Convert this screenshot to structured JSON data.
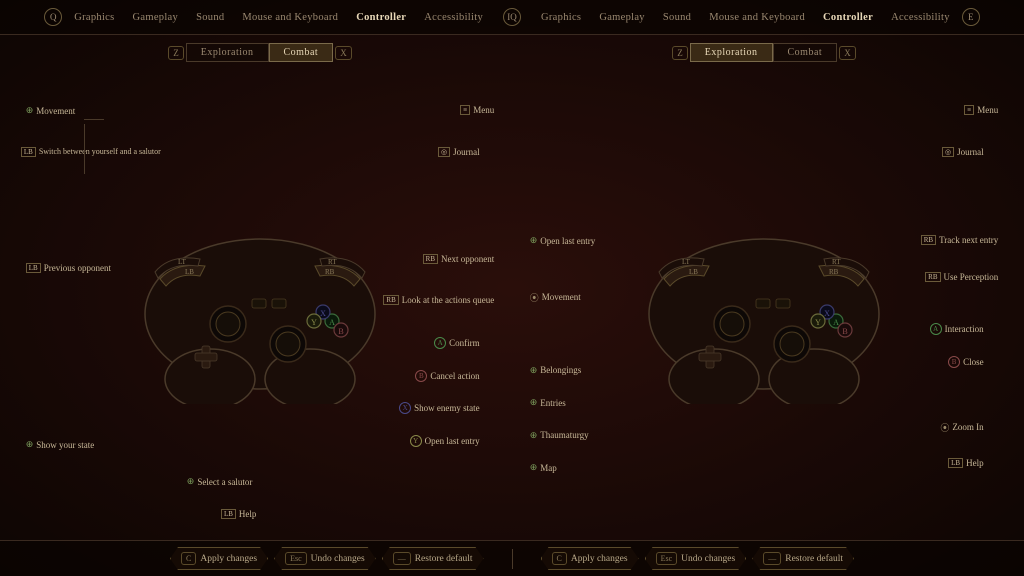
{
  "nav": {
    "left_q": "Q",
    "items_left": [
      "Graphics",
      "Gameplay",
      "Sound",
      "Mouse and Keyboard",
      "Controller",
      "Accessibility"
    ],
    "middle_iq": "IQ",
    "items_right": [
      "Graphics",
      "Gameplay",
      "Sound",
      "Mouse and Keyboard",
      "Controller",
      "Accessibility"
    ],
    "right_e": "E",
    "active": "Controller"
  },
  "panels": [
    {
      "id": "left",
      "tabs": [
        {
          "key": "Z",
          "label": "Exploration",
          "active": false
        },
        {
          "key": null,
          "label": "Combat",
          "active": true
        },
        {
          "key": "X",
          "label": null,
          "active": false
        }
      ],
      "labels_left": [
        {
          "text": "Movement",
          "icon": "dpad",
          "top": "16%",
          "left": "9%"
        },
        {
          "text": "Switch between yourself and a salutor",
          "icon": "lb",
          "top": "22%",
          "left": "5%"
        },
        {
          "text": "Previous opponent",
          "icon": "lb",
          "top": "40%",
          "left": "6%"
        },
        {
          "text": "Show your state",
          "icon": "dpad",
          "top": "76%",
          "left": "9%"
        }
      ],
      "labels_right": [
        {
          "text": "Menu",
          "icon": "menu",
          "top": "16%",
          "right": "5%"
        },
        {
          "text": "Journal",
          "icon": "menu",
          "top": "22%",
          "right": "8%"
        },
        {
          "text": "Next opponent",
          "icon": "rb",
          "top": "40%",
          "right": "5%"
        },
        {
          "text": "Look at the actions queue",
          "icon": "rb",
          "top": "46%",
          "right": "5%"
        },
        {
          "text": "Confirm",
          "icon": "a",
          "top": "54%",
          "right": "8%"
        },
        {
          "text": "Cancel action",
          "icon": "b",
          "top": "60%",
          "right": "8%"
        },
        {
          "text": "Show enemy state",
          "icon": "x",
          "top": "66%",
          "right": "8%"
        },
        {
          "text": "Open last entry",
          "icon": "y",
          "top": "72%",
          "right": "8%"
        },
        {
          "text": "Select a salutor",
          "icon": "dpad",
          "top": "82%",
          "left": "42%"
        },
        {
          "text": "Help",
          "icon": "lb",
          "top": "88%",
          "left": "44%"
        }
      ]
    },
    {
      "id": "right",
      "tabs": [
        {
          "key": "Z",
          "label": "Exploration",
          "active": true
        },
        {
          "key": null,
          "label": "Combat",
          "active": false
        },
        {
          "key": "X",
          "label": null,
          "active": false
        }
      ],
      "labels": [
        {
          "text": "Open last entry",
          "icon": "dpad",
          "side": "left",
          "top": "38%"
        },
        {
          "text": "Movement",
          "icon": "stick",
          "side": "left",
          "top": "50%"
        },
        {
          "text": "Belongings",
          "icon": "dpad",
          "side": "left",
          "top": "64%"
        },
        {
          "text": "Entries",
          "icon": "dpad",
          "side": "left",
          "top": "70%"
        },
        {
          "text": "Thaumaturgy",
          "icon": "dpad",
          "side": "left",
          "top": "76%"
        },
        {
          "text": "Map",
          "icon": "dpad",
          "side": "left",
          "top": "82%"
        },
        {
          "text": "Menu",
          "icon": "menu",
          "side": "right",
          "top": "16%"
        },
        {
          "text": "Journal",
          "icon": "menu",
          "side": "right",
          "top": "22%"
        },
        {
          "text": "Track next entry",
          "icon": "rb",
          "side": "right",
          "top": "38%"
        },
        {
          "text": "Use Perception",
          "icon": "rb",
          "side": "right",
          "top": "44%"
        },
        {
          "text": "Interaction",
          "icon": "a",
          "side": "right",
          "top": "54%"
        },
        {
          "text": "Close",
          "icon": "b",
          "side": "right",
          "top": "60%"
        },
        {
          "text": "Zoom In",
          "icon": "stick",
          "side": "right",
          "top": "76%"
        },
        {
          "text": "Help",
          "icon": "lb",
          "side": "right",
          "top": "82%"
        }
      ]
    }
  ],
  "bottom": {
    "left": [
      {
        "key": "C",
        "label": "Apply changes"
      },
      {
        "key": "Esc",
        "label": "Undo changes"
      },
      {
        "key": "—",
        "label": "Restore default"
      }
    ],
    "right": [
      {
        "key": "C",
        "label": "Apply changes"
      },
      {
        "key": "Esc",
        "label": "Undo changes"
      },
      {
        "key": "—",
        "label": "Restore default"
      }
    ]
  }
}
